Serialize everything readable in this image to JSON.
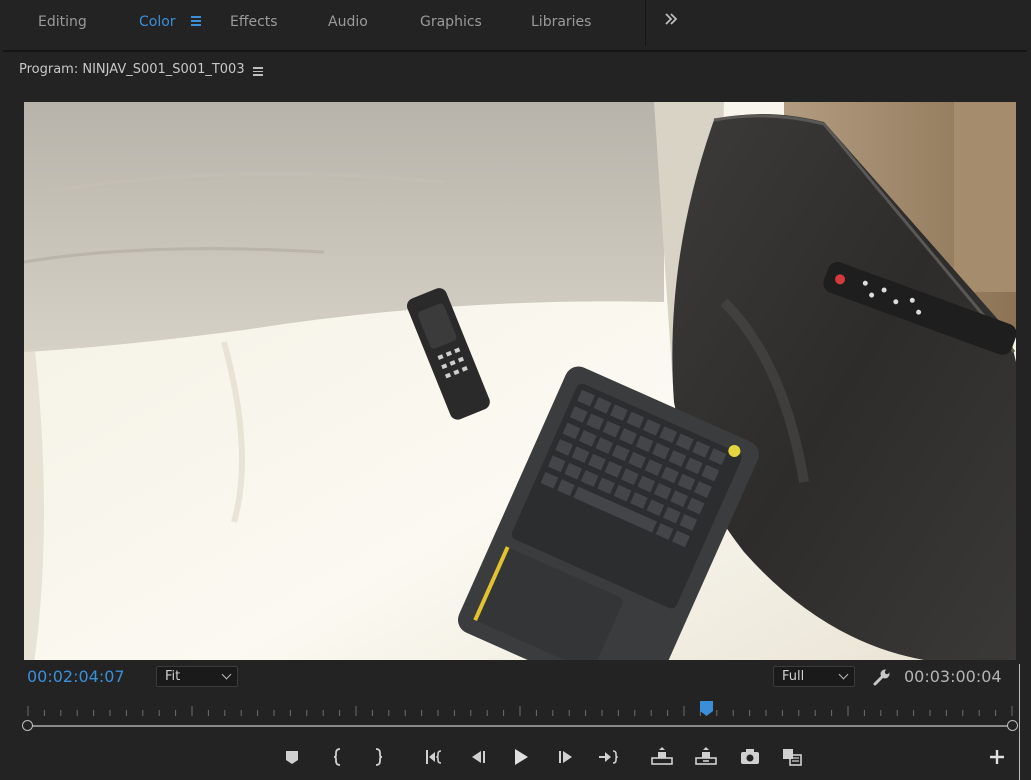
{
  "workspace_tabs": {
    "editing": "Editing",
    "color": "Color",
    "effects": "Effects",
    "audio": "Audio",
    "graphics": "Graphics",
    "libraries": "Libraries"
  },
  "active_workspace": "Color",
  "panel": {
    "title": "Program: NINJAV_S001_S001_T003"
  },
  "video": {
    "description_icon": "video-frame"
  },
  "controls": {
    "current_timecode": "00:02:04:07",
    "zoom_value": "Fit",
    "quality_value": "Full",
    "duration_timecode": "00:03:00:04"
  },
  "playhead_fraction": 0.69,
  "transport": [
    {
      "name": "add-marker-icon"
    },
    {
      "name": "mark-in-icon"
    },
    {
      "name": "mark-out-icon"
    },
    {
      "name": "go-to-in-icon"
    },
    {
      "name": "step-back-icon"
    },
    {
      "name": "play-icon"
    },
    {
      "name": "step-forward-icon"
    },
    {
      "name": "go-to-out-icon"
    },
    {
      "name": "lift-icon"
    },
    {
      "name": "extract-icon"
    },
    {
      "name": "export-frame-icon"
    },
    {
      "name": "comparison-view-icon"
    },
    {
      "name": "button-editor-plus-icon"
    }
  ],
  "colors": {
    "accent": "#3a8fd8",
    "background": "#232323",
    "text": "#b4b4b4"
  }
}
